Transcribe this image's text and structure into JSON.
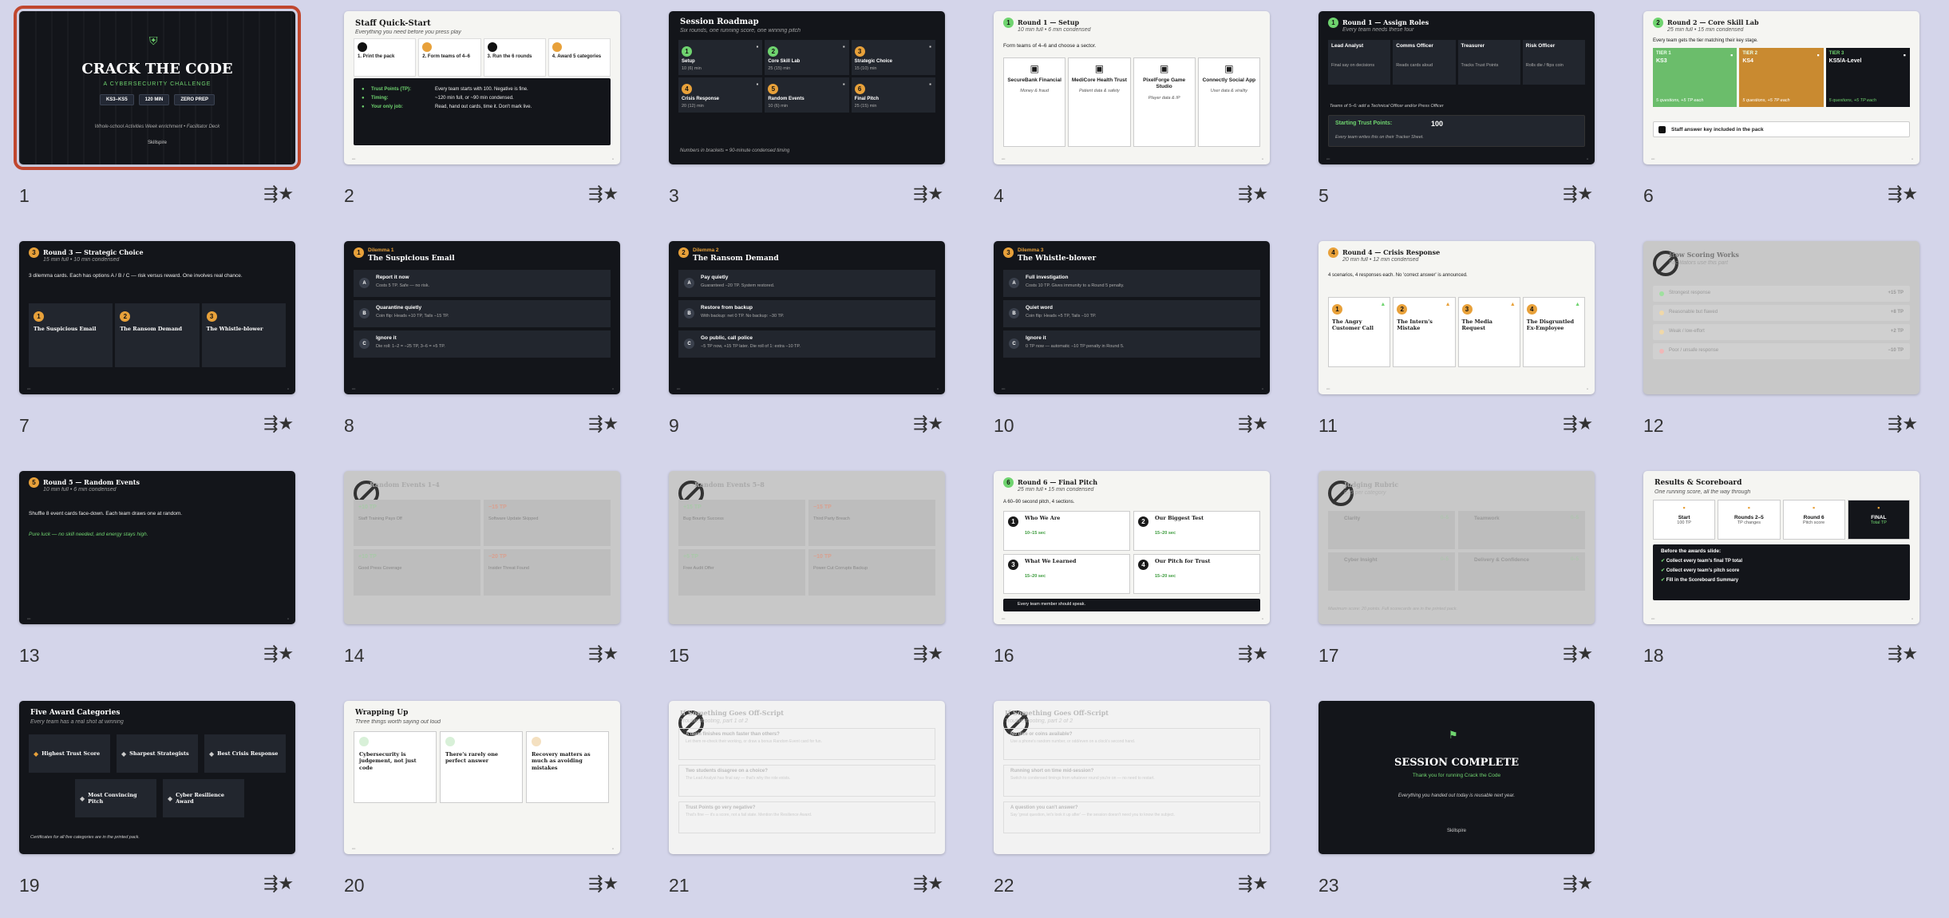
{
  "slides": [
    {
      "num": "1",
      "title": "CRACK THE CODE",
      "subtitle": "A CYBERSECURITY CHALLENGE",
      "chips": [
        "KS3–KS5",
        "120 MIN",
        "ZERO PREP"
      ],
      "note": "Whole-school Activities Week enrichment  •  Facilitator Deck",
      "brand": "Skillspire"
    },
    {
      "num": "2",
      "title": "Staff Quick-Start",
      "subtitle": "Everything you need before you press play",
      "steps": [
        "1. Print the pack",
        "2. Form teams of 4–6",
        "3. Run the 6 rounds",
        "4. Award 5 categories"
      ],
      "rows": [
        [
          "Trust Points (TP):",
          "Every team starts with 100. Negative is fine."
        ],
        [
          "Timing:",
          "~120 min full, or ~90 min condensed."
        ],
        [
          "Your only job:",
          "Read, hand out cards, time it. Don't mark live."
        ]
      ]
    },
    {
      "num": "3",
      "title": "Session Roadmap",
      "subtitle": "Six rounds, one running score, one winning pitch",
      "rounds": [
        [
          "1",
          "Setup",
          "10 (6) min"
        ],
        [
          "2",
          "Core Skill Lab",
          "25 (15) min"
        ],
        [
          "3",
          "Strategic Choice",
          "15 (10) min"
        ],
        [
          "4",
          "Crisis Response",
          "20 (12) min"
        ],
        [
          "5",
          "Random Events",
          "10 (6) min"
        ],
        [
          "6",
          "Final Pitch",
          "25 (15) min"
        ]
      ],
      "note": "Numbers in brackets = 90-minute condensed timing"
    },
    {
      "num": "4",
      "badge": "1",
      "title": "Round 1 — Setup",
      "subtitle": "10 min full  •  6 min condensed",
      "intro": "Form teams of 4–6 and choose a sector.",
      "sectors": [
        [
          "SecureBank Financial",
          "Money & fraud"
        ],
        [
          "MediCore Health Trust",
          "Patient data & safety"
        ],
        [
          "PixelForge Game Studio",
          "Player data & IP"
        ],
        [
          "Connectly Social App",
          "User data & virality"
        ]
      ]
    },
    {
      "num": "5",
      "badge": "1",
      "title": "Round 1 — Assign Roles",
      "subtitle": "Every team needs these four",
      "roles": [
        [
          "Lead Analyst",
          "Final say on decisions"
        ],
        [
          "Comms Officer",
          "Reads cards aloud"
        ],
        [
          "Treasurer",
          "Tracks Trust Points"
        ],
        [
          "Risk Officer",
          "Rolls die / flips coin"
        ]
      ],
      "note": "Teams of 5–6: add a Technical Officer and/or Press Officer",
      "tp_label": "Starting Trust Points:",
      "tp_value": "100",
      "tp_note": "Every team writes this on their Tracker Sheet."
    },
    {
      "num": "6",
      "badge": "2",
      "title": "Round 2 — Core Skill Lab",
      "subtitle": "25 min full  •  15 min condensed",
      "intro": "Every team gets the tier matching their key stage.",
      "tiers": [
        [
          "TIER 1",
          "KS3",
          "5 questions, +5 TP each"
        ],
        [
          "TIER 2",
          "KS4",
          "5 questions, +5 TP each"
        ],
        [
          "TIER 3",
          "KS5/A-Level",
          "5 questions, +5 TP each"
        ]
      ],
      "note": "Staff answer key included in the pack"
    },
    {
      "num": "7",
      "badge": "3",
      "title": "Round 3 — Strategic Choice",
      "subtitle": "15 min full  •  10 min condensed",
      "intro": "3 dilemma cards. Each has options A / B / C — risk versus reward. One involves real chance.",
      "cards": [
        "The Suspicious Email",
        "The Ransom Demand",
        "The Whistle-blower"
      ]
    },
    {
      "num": "8",
      "badge": "1",
      "kicker": "Dilemma 1",
      "title": "The Suspicious Email",
      "options": [
        [
          "A",
          "Report it now",
          "Costs 5 TP. Safe — no risk."
        ],
        [
          "B",
          "Quarantine quietly",
          "Coin flip: Heads +10 TP, Tails −15 TP."
        ],
        [
          "C",
          "Ignore it",
          "Die roll: 1–2 = −25 TP, 3–6 = +5 TP."
        ]
      ]
    },
    {
      "num": "9",
      "badge": "2",
      "kicker": "Dilemma 2",
      "title": "The Ransom Demand",
      "options": [
        [
          "A",
          "Pay quietly",
          "Guaranteed −20 TP. System restored."
        ],
        [
          "B",
          "Restore from backup",
          "With backup: net 0 TP. No backup: −30 TP."
        ],
        [
          "C",
          "Go public, call police",
          "−5 TP now, +15 TP later. Die roll of 1: extra −10 TP."
        ]
      ]
    },
    {
      "num": "10",
      "badge": "3",
      "kicker": "Dilemma 3",
      "title": "The Whistle-blower",
      "options": [
        [
          "A",
          "Full investigation",
          "Costs 10 TP. Gives immunity to a Round 5 penalty."
        ],
        [
          "B",
          "Quiet word",
          "Coin flip: Heads +5 TP, Tails −10 TP."
        ],
        [
          "C",
          "Ignore it",
          "0 TP now — automatic −10 TP penalty in Round 5."
        ]
      ]
    },
    {
      "num": "11",
      "badge": "4",
      "title": "Round 4 — Crisis Response",
      "subtitle": "20 min full  •  12 min condensed",
      "intro": "4 scenarios, 4 responses each. No 'correct answer' is announced.",
      "cards": [
        "The Angry Customer Call",
        "The Intern's Mistake",
        "The Media Request",
        "The Disgruntled Ex-Employee"
      ]
    },
    {
      "num": "12",
      "title": "How Scoring Works",
      "subtitle": "Facilitators use this part",
      "rows": [
        [
          "Strongest response",
          "+15 TP"
        ],
        [
          "Reasonable but flawed",
          "+8 TP"
        ],
        [
          "Weak / low-effort",
          "+2 TP"
        ],
        [
          "Poor / unsafe response",
          "−10 TP"
        ]
      ]
    },
    {
      "num": "13",
      "badge": "5",
      "title": "Round 5 — Random Events",
      "subtitle": "10 min full  •  6 min condensed",
      "intro": "Shuffle 8 event cards face-down. Each team draws one at random.",
      "accent": "Pure luck — no skill needed, and energy stays high."
    },
    {
      "num": "14",
      "title": "Random Events 1–4",
      "events": [
        [
          "+10 TP",
          "Staff Training Pays Off"
        ],
        [
          "−15 TP",
          "Software Update Skipped"
        ],
        [
          "+10 TP",
          "Good Press Coverage"
        ],
        [
          "−20 TP",
          "Insider Threat Found"
        ]
      ]
    },
    {
      "num": "15",
      "title": "Random Events 5–8",
      "events": [
        [
          "+15 TP",
          "Bug Bounty Success"
        ],
        [
          "−15 TP",
          "Third Party Breach"
        ],
        [
          "+5 TP",
          "Free Audit Offer"
        ],
        [
          "−10 TP",
          "Power Cut Corrupts Backup"
        ]
      ]
    },
    {
      "num": "16",
      "badge": "6",
      "title": "Round 6 — Final Pitch",
      "subtitle": "25 min full  •  15 min condensed",
      "intro": "A 60–90 second pitch, 4 sections.",
      "sections": [
        [
          "1",
          "Who We Are",
          "10–15 sec"
        ],
        [
          "2",
          "Our Biggest Test",
          "15–20 sec"
        ],
        [
          "3",
          "What We Learned",
          "15–20 sec"
        ],
        [
          "4",
          "Our Pitch for Trust",
          "15–20 sec"
        ]
      ],
      "note": "Every team member should speak."
    },
    {
      "num": "17",
      "title": "Judging Rubric",
      "subtitle": "0–5 per category",
      "rows": [
        [
          "Clarity",
          "0–5"
        ],
        [
          "Teamwork",
          "0–5"
        ],
        [
          "Cyber Insight",
          "0–5"
        ],
        [
          "Delivery & Confidence",
          "0–5"
        ]
      ],
      "note": "Maximum score: 20 points. Full scorecards are in the printed pack."
    },
    {
      "num": "18",
      "title": "Results & Scoreboard",
      "subtitle": "One running score, all the way through",
      "steps": [
        [
          "Start",
          "100 TP"
        ],
        [
          "Rounds 2–5",
          "TP changes"
        ],
        [
          "Round 6",
          "Pitch score"
        ],
        [
          "FINAL",
          "Total TP"
        ]
      ],
      "head": "Before the awards slide:",
      "checks": [
        "Collect every team's final TP total",
        "Collect every team's pitch score",
        "Fill in the Scoreboard Summary"
      ]
    },
    {
      "num": "19",
      "title": "Five Award Categories",
      "subtitle": "Every team has a real shot at winning",
      "awards": [
        "Highest Trust Score",
        "Sharpest Strategists",
        "Best Crisis Response",
        "Most Convincing Pitch",
        "Cyber Resilience Award"
      ],
      "note": "Certificates for all five categories are in the printed pack."
    },
    {
      "num": "20",
      "title": "Wrapping Up",
      "subtitle": "Three things worth saying out loud",
      "points": [
        "Cybersecurity is judgement, not just code",
        "There's rarely one perfect answer",
        "Recovery matters as much as avoiding mistakes"
      ]
    },
    {
      "num": "21",
      "title": "If Something Goes Off-Script",
      "subtitle": "Troubleshooting, part 1 of 2",
      "rows": [
        [
          "A team finishes much faster than others?",
          "Let them re-check their working, or draw a bonus Random Event card for fun."
        ],
        [
          "Two students disagree on a choice?",
          "The Lead Analyst has final say — that's why the role exists."
        ],
        [
          "Trust Points go very negative?",
          "That's fine — it's a score, not a fail state. Mention the Resilience Award."
        ]
      ]
    },
    {
      "num": "22",
      "title": "If Something Goes Off-Script",
      "subtitle": "Troubleshooting, part 2 of 2",
      "rows": [
        [
          "No dice or coins available?",
          "Use a phone's random number, or odd/even on a clock's second hand."
        ],
        [
          "Running short on time mid-session?",
          "Switch to condensed timings from whatever round you're on — no need to restart."
        ],
        [
          "A question you can't answer?",
          "Say 'great question, let's look it up after' — the session doesn't need you to know the subject."
        ]
      ]
    },
    {
      "num": "23",
      "title": "SESSION COMPLETE",
      "subtitle": "Thank you for running Crack the Code",
      "note": "Everything you handed out today is reusable next year.",
      "brand": "Skillspire"
    }
  ],
  "colors": {
    "accent": "#c0472f",
    "green": "#6fd46f",
    "orange": "#e8a13a",
    "dark": "#13151a",
    "bg": "#d4d5ea"
  },
  "icons": {
    "star": "star-icon",
    "hidden": "hidden-slide-icon"
  }
}
